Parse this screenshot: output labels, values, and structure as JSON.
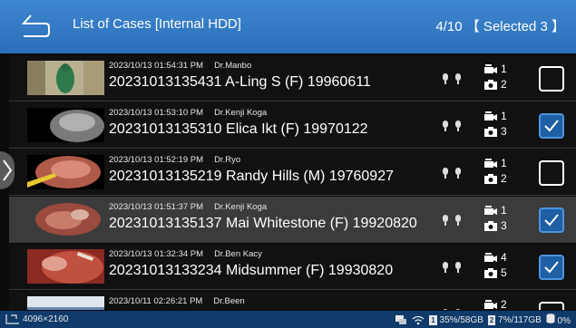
{
  "header": {
    "title": "List of Cases [Internal HDD]",
    "count": "4/10 【 Selected 3 】"
  },
  "cases": [
    {
      "timestamp": "2023/10/13 01:54:31 PM",
      "doctor": "Dr.Manbo",
      "name": "20231013135431 A-Ling S (F) 19960611",
      "videos": "1",
      "photos": "2",
      "selected": false
    },
    {
      "timestamp": "2023/10/13 01:53:10 PM",
      "doctor": "Dr.Kenji Koga",
      "name": "20231013135310 Elica Ikt (F) 19970122",
      "videos": "1",
      "photos": "3",
      "selected": true
    },
    {
      "timestamp": "2023/10/13 01:52:19 PM",
      "doctor": "Dr.Ryo",
      "name": "20231013135219 Randy Hills (M) 19760927",
      "videos": "1",
      "photos": "2",
      "selected": false
    },
    {
      "timestamp": "2023/10/13 01:51:37 PM",
      "doctor": "Dr.Kenji Koga",
      "name": "20231013135137 Mai Whitestone (F) 19920820",
      "videos": "1",
      "photos": "3",
      "selected": true
    },
    {
      "timestamp": "2023/10/13 01:32:34 PM",
      "doctor": "Dr.Ben Kacy",
      "name": "20231013133234 Midsummer (F) 19930820",
      "videos": "4",
      "photos": "5",
      "selected": true
    },
    {
      "timestamp": "2023/10/11 02:26:21 PM",
      "doctor": "Dr.Been",
      "name": "",
      "videos": "2",
      "photos": "",
      "selected": false
    }
  ],
  "status": {
    "resolution": "4096×2160",
    "disk1_label": "1",
    "disk1_usage": "35%/58GB",
    "disk2_label": "2",
    "disk2_usage": "7%/117GB",
    "disk3_usage": "0%"
  },
  "colors": {
    "header": "#2f78c4",
    "status_bar": "#0f3a6a",
    "checked": "#1f5fa4",
    "row_highlight": "#3b3b3b"
  },
  "icons": {
    "back": "return-arrow-icon",
    "microphone": "microphone-icon",
    "video_count": "video-camera-icon",
    "photo_count": "camera-icon",
    "check": "checkmark-icon",
    "side_tab": "chevron-right-icon"
  }
}
